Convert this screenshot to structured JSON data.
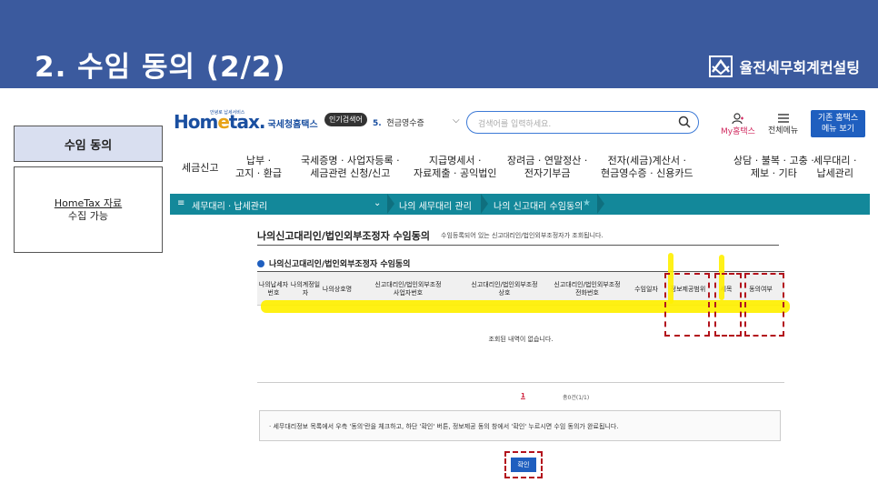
{
  "slide": {
    "title": "2. 수임 동의 (2/2)",
    "company": "율전세무회계컨설팅",
    "left_label": "수임 동의",
    "left_note_line1": "HomeTax 자료",
    "left_note_line2": "수집 가능"
  },
  "hometax": {
    "logo_main_pre": "Hom",
    "logo_main_mid": "e",
    "logo_main_post": "tax.",
    "logo_sub": "국세청홈택스",
    "logo_tiny": "안녕로 납세서비스",
    "popular_badge": "인기검색어",
    "popular_rank": "5.",
    "popular_term": "현금영수증",
    "search_placeholder": "검색어를 입력하세요.",
    "my_label": "My홈택스",
    "all_menu_label": "전체메뉴",
    "old_btn_line1": "기존 홈택스",
    "old_btn_line2": "메뉴 보기"
  },
  "nav": [
    "세금신고",
    "납부 ·\n고지 · 환급",
    "국세증명 · 사업자등록 ·\n세금관련 신청/신고",
    "지급명세서 ·\n자료제출 · 공익법인",
    "장려금 · 연말정산 ·\n전자기부금",
    "전자(세금)계산서 ·\n현금영수증 · 신용카드",
    "상담 · 불복 · 고충 ·\n제보 · 기타",
    "세무대리 ·\n납세관리"
  ],
  "breadcrumb": {
    "menu": "세무대리 · 납세관리",
    "level2": "나의 세무대리 관리",
    "level3": "나의 신고대리 수임동의"
  },
  "content": {
    "page_title": "나의신고대리인/법인외부조정자 수임동의",
    "page_desc": "수임등록되어 있는 신고대리인/법인외부조정자가 조회됩니다.",
    "section_title": "나의신고대리인/법인외부조정자 수임동의",
    "columns": [
      "나의납세자번호",
      "나의계정일자",
      "나의상호명",
      "신고대리인/법인외부조정\n사업자번호",
      "신고대리인/법인외부조정\n상호",
      "신고대리인/법인외부조정\n전화번호",
      "수임일자",
      "정보제공범위",
      "세목",
      "동의여부"
    ],
    "no_result": "조회된 내역이 없습니다.",
    "page_number": "1",
    "total": "총0건(1/1)",
    "notice": "· 세무대리정보 목록에서 우측 '동의'란을 체크하고, 하단 '확인' 버튼, 정보제공 동의 창에서 '확인' 누르시면 수임 동의가 완료됩니다.",
    "confirm_label": "확인"
  },
  "colors": {
    "header_bg": "#3b5a9e",
    "bluebar": "#13889a",
    "accent": "#1f5fbf",
    "highlight": "#fff000",
    "dash": "#b3121c"
  }
}
